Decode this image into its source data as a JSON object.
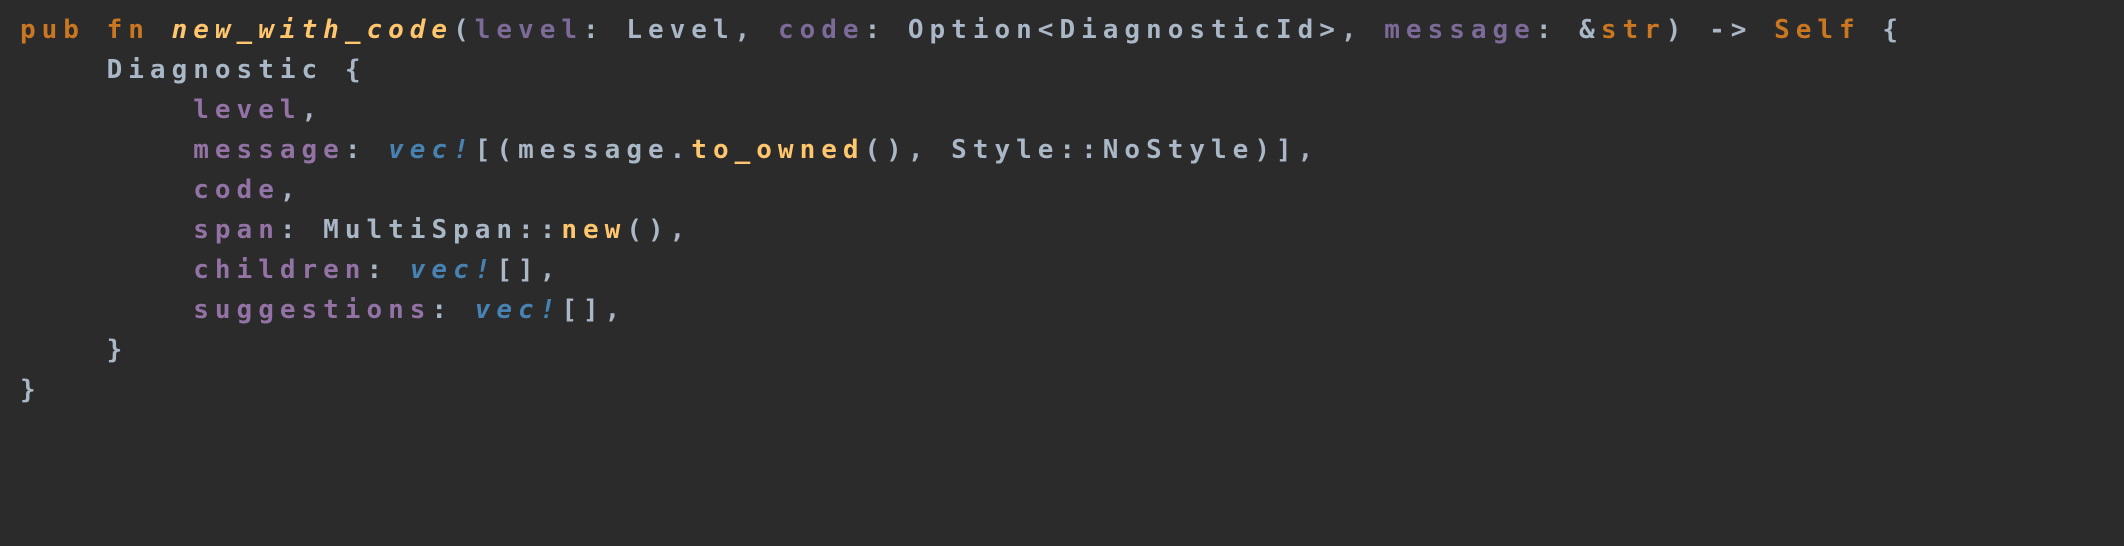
{
  "code": {
    "line1": {
      "pub": "pub",
      "fn": "fn",
      "fname": "new_with_code",
      "lparen": "(",
      "p1name": "level",
      "colon1": ":",
      "sp": " ",
      "p1type": "Level",
      "comma1": ",",
      "p2name": "code",
      "colon2": ":",
      "p2type": "Option<DiagnosticId>",
      "comma2": ",",
      "p3name": "message",
      "colon3": ":",
      "amp": "&",
      "str": "str",
      "rparen": ")",
      "arrow": " -> ",
      "self": "Self",
      "lbrace": " {"
    },
    "line2": {
      "indent": "    ",
      "struct": "Diagnostic",
      "lbrace": " {"
    },
    "line3": {
      "indent": "        ",
      "field": "level",
      "comma": ","
    },
    "line4": {
      "indent": "        ",
      "field": "message",
      "colon": ": ",
      "vec": "vec!",
      "lbrack": "[(",
      "arg": "message.",
      "call": "to_owned",
      "paren": "(), ",
      "style": "Style::NoStyle",
      "rbrack": ")],"
    },
    "line5": {
      "indent": "        ",
      "field": "code",
      "comma": ","
    },
    "line6": {
      "indent": "        ",
      "field": "span",
      "colon": ": ",
      "type": "MultiSpan::",
      "call": "new",
      "paren": "(),"
    },
    "line7": {
      "indent": "        ",
      "field": "children",
      "colon": ": ",
      "vec": "vec!",
      "brack": "[],"
    },
    "line8": {
      "indent": "        ",
      "field": "suggestions",
      "colon": ": ",
      "vec": "vec!",
      "brack": "[],"
    },
    "line9": {
      "indent": "    ",
      "rbrace": "}"
    },
    "line10": {
      "rbrace": "}"
    }
  }
}
